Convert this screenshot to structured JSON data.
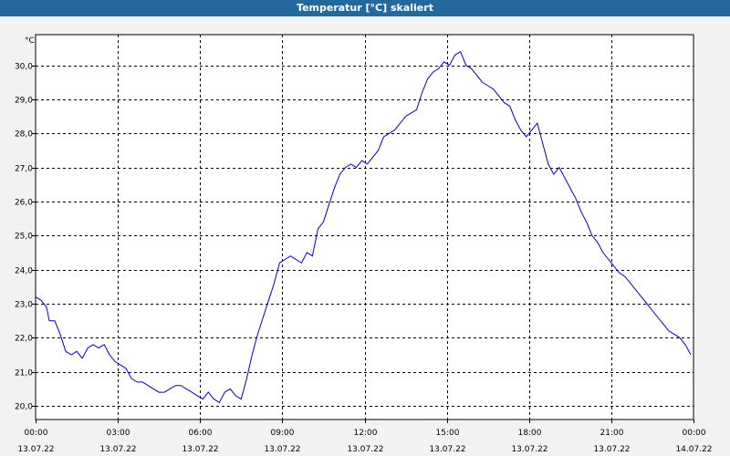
{
  "window": {
    "title": "Temperatur [°C] skaliert"
  },
  "chart_data": {
    "type": "line",
    "title": "Temperatur [°C] skaliert",
    "ylabel": "°C",
    "xlabel": "",
    "ylim": [
      19.6,
      30.9
    ],
    "xlim": [
      0,
      24
    ],
    "grid": true,
    "y_ticks": [
      "20,0",
      "21,0",
      "22,0",
      "23,0",
      "24,0",
      "25,0",
      "26,0",
      "27,0",
      "28,0",
      "29,0",
      "30,0"
    ],
    "x_ticks": [
      {
        "time": "00:00",
        "date": "13.07.22"
      },
      {
        "time": "03:00",
        "date": "13.07.22"
      },
      {
        "time": "06:00",
        "date": "13.07.22"
      },
      {
        "time": "09:00",
        "date": "13.07.22"
      },
      {
        "time": "12:00",
        "date": "13.07.22"
      },
      {
        "time": "15:00",
        "date": "13.07.22"
      },
      {
        "time": "18:00",
        "date": "13.07.22"
      },
      {
        "time": "21:00",
        "date": "13.07.22"
      },
      {
        "time": "00:00",
        "date": "14.07.22"
      }
    ],
    "series": [
      {
        "color": "#0000cc",
        "x": [
          0.0,
          0.2,
          0.4,
          0.5,
          0.7,
          0.9,
          1.1,
          1.3,
          1.5,
          1.7,
          1.9,
          2.1,
          2.3,
          2.5,
          2.7,
          2.9,
          3.1,
          3.3,
          3.5,
          3.7,
          3.9,
          4.1,
          4.3,
          4.5,
          4.7,
          4.9,
          5.1,
          5.3,
          5.5,
          5.7,
          5.9,
          6.1,
          6.3,
          6.5,
          6.7,
          6.9,
          7.1,
          7.3,
          7.5,
          7.7,
          7.9,
          8.1,
          8.3,
          8.5,
          8.7,
          8.9,
          9.1,
          9.3,
          9.5,
          9.7,
          9.9,
          10.1,
          10.3,
          10.5,
          10.7,
          10.9,
          11.1,
          11.3,
          11.5,
          11.7,
          11.9,
          12.1,
          12.3,
          12.5,
          12.7,
          12.9,
          13.1,
          13.3,
          13.5,
          13.7,
          13.9,
          14.1,
          14.3,
          14.5,
          14.7,
          14.9,
          15.1,
          15.3,
          15.5,
          15.7,
          15.9,
          16.1,
          16.3,
          16.5,
          16.7,
          16.9,
          17.1,
          17.3,
          17.5,
          17.7,
          17.9,
          18.1,
          18.3,
          18.5,
          18.7,
          18.9,
          19.1,
          19.3,
          19.5,
          19.7,
          19.9,
          20.1,
          20.3,
          20.5,
          20.7,
          20.9,
          21.1,
          21.3,
          21.5,
          21.7,
          21.9,
          22.1,
          22.3,
          22.5,
          22.7,
          22.9,
          23.1,
          23.3,
          23.5,
          23.7,
          23.9
        ],
        "y": [
          23.2,
          23.1,
          22.9,
          22.5,
          22.5,
          22.1,
          21.6,
          21.5,
          21.6,
          21.4,
          21.7,
          21.8,
          21.7,
          21.8,
          21.5,
          21.3,
          21.2,
          21.1,
          20.8,
          20.7,
          20.7,
          20.6,
          20.5,
          20.4,
          20.4,
          20.5,
          20.6,
          20.6,
          20.5,
          20.4,
          20.3,
          20.2,
          20.4,
          20.2,
          20.1,
          20.4,
          20.5,
          20.3,
          20.2,
          20.8,
          21.5,
          22.1,
          22.6,
          23.1,
          23.6,
          24.2,
          24.3,
          24.4,
          24.3,
          24.2,
          24.5,
          24.4,
          25.2,
          25.4,
          25.9,
          26.4,
          26.8,
          27.0,
          27.1,
          27.0,
          27.2,
          27.1,
          27.3,
          27.5,
          27.9,
          28.0,
          28.1,
          28.3,
          28.5,
          28.6,
          28.7,
          29.2,
          29.6,
          29.8,
          29.9,
          30.1,
          30.0,
          30.3,
          30.4,
          30.0,
          29.9,
          29.7,
          29.5,
          29.4,
          29.3,
          29.1,
          28.9,
          28.8,
          28.4,
          28.1,
          27.9,
          28.1,
          28.3,
          27.7,
          27.1,
          26.8,
          27.0,
          26.7,
          26.4,
          26.1,
          25.7,
          25.4,
          25.0,
          24.8,
          24.5,
          24.3,
          24.1,
          23.9,
          23.8,
          23.6,
          23.4,
          23.2,
          23.0,
          22.8,
          22.6,
          22.4,
          22.2,
          22.1,
          22.0,
          21.8,
          21.5
        ]
      }
    ]
  }
}
